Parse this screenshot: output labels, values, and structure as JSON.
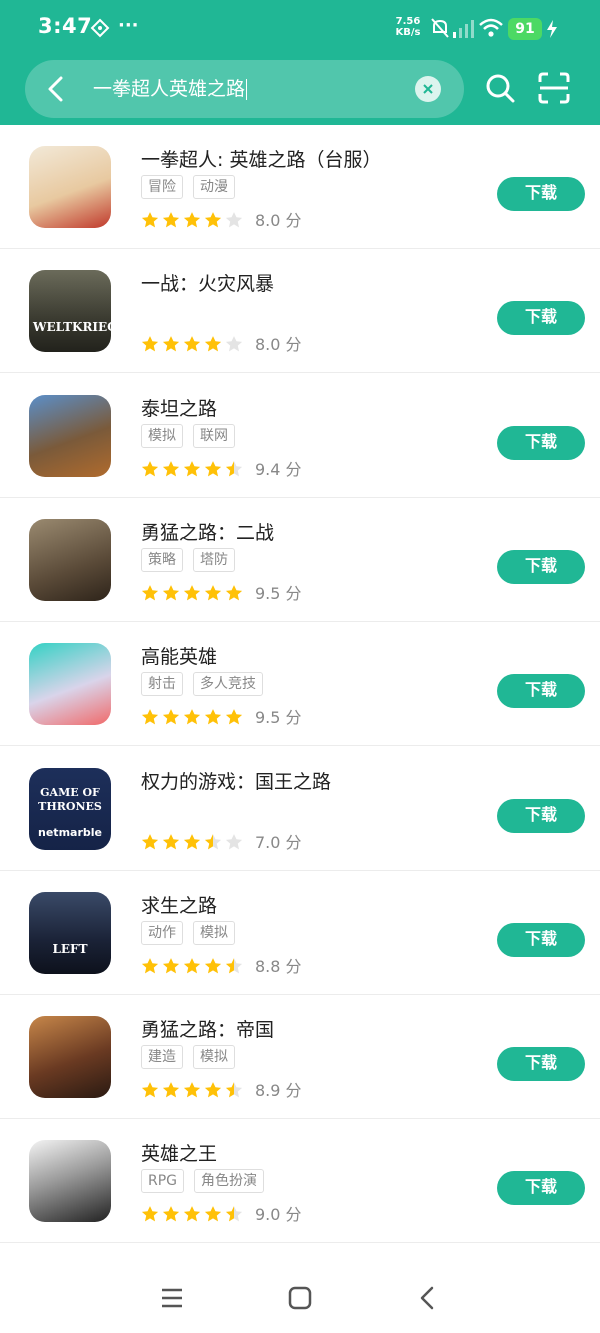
{
  "status_bar": {
    "time": "3:47",
    "extra": "···",
    "net_speed_value": "7.56",
    "net_speed_unit": "KB/s",
    "battery": "91"
  },
  "search": {
    "query": "一拳超人英雄之路"
  },
  "colors": {
    "accent": "#20b795",
    "star_filled": "#ffc107",
    "star_empty": "#e4e4e4"
  },
  "score_unit": "分",
  "apps": [
    {
      "title": "一拳超人: 英雄之路（台服）",
      "tags": [
        "冒险",
        "动漫"
      ],
      "rating": 4,
      "score": "8.0",
      "button": "下载",
      "icon_name": "one-punch-man-icon"
    },
    {
      "title": "一战：火灾风暴",
      "tags": [],
      "rating": 4,
      "score": "8.0",
      "button": "下载",
      "icon_name": "weltkrieg-icon",
      "icon_text": "WELTKRIEG"
    },
    {
      "title": "泰坦之路",
      "tags": [
        "模拟",
        "联网"
      ],
      "rating": 4.5,
      "score": "9.4",
      "button": "下载",
      "icon_name": "dinosaur-icon"
    },
    {
      "title": "勇猛之路：二战",
      "tags": [
        "策略",
        "塔防"
      ],
      "rating": 5,
      "score": "9.5",
      "button": "下载",
      "icon_name": "soldier-icon"
    },
    {
      "title": "高能英雄",
      "tags": [
        "射击",
        "多人竞技"
      ],
      "rating": 5,
      "score": "9.5",
      "button": "下载",
      "icon_name": "hero-girl-icon"
    },
    {
      "title": "权力的游戏：国王之路",
      "tags": [],
      "rating": 3.5,
      "score": "7.0",
      "button": "下载",
      "icon_name": "game-of-thrones-icon",
      "icon_text": "GAME OF THRONES",
      "icon_sub": "netmarble"
    },
    {
      "title": "求生之路",
      "tags": [
        "动作",
        "模拟"
      ],
      "rating": 4.5,
      "score": "8.8",
      "button": "下载",
      "icon_name": "left-survive-icon",
      "icon_text": "LEFT"
    },
    {
      "title": "勇猛之路：帝国",
      "tags": [
        "建造",
        "模拟"
      ],
      "rating": 4.5,
      "score": "8.9",
      "button": "下载",
      "icon_name": "roman-warrior-icon"
    },
    {
      "title": "英雄之王",
      "tags": [
        "RPG",
        "角色扮演"
      ],
      "rating": 4.5,
      "score": "9.0",
      "button": "下载",
      "icon_name": "anime-hero-icon"
    }
  ]
}
